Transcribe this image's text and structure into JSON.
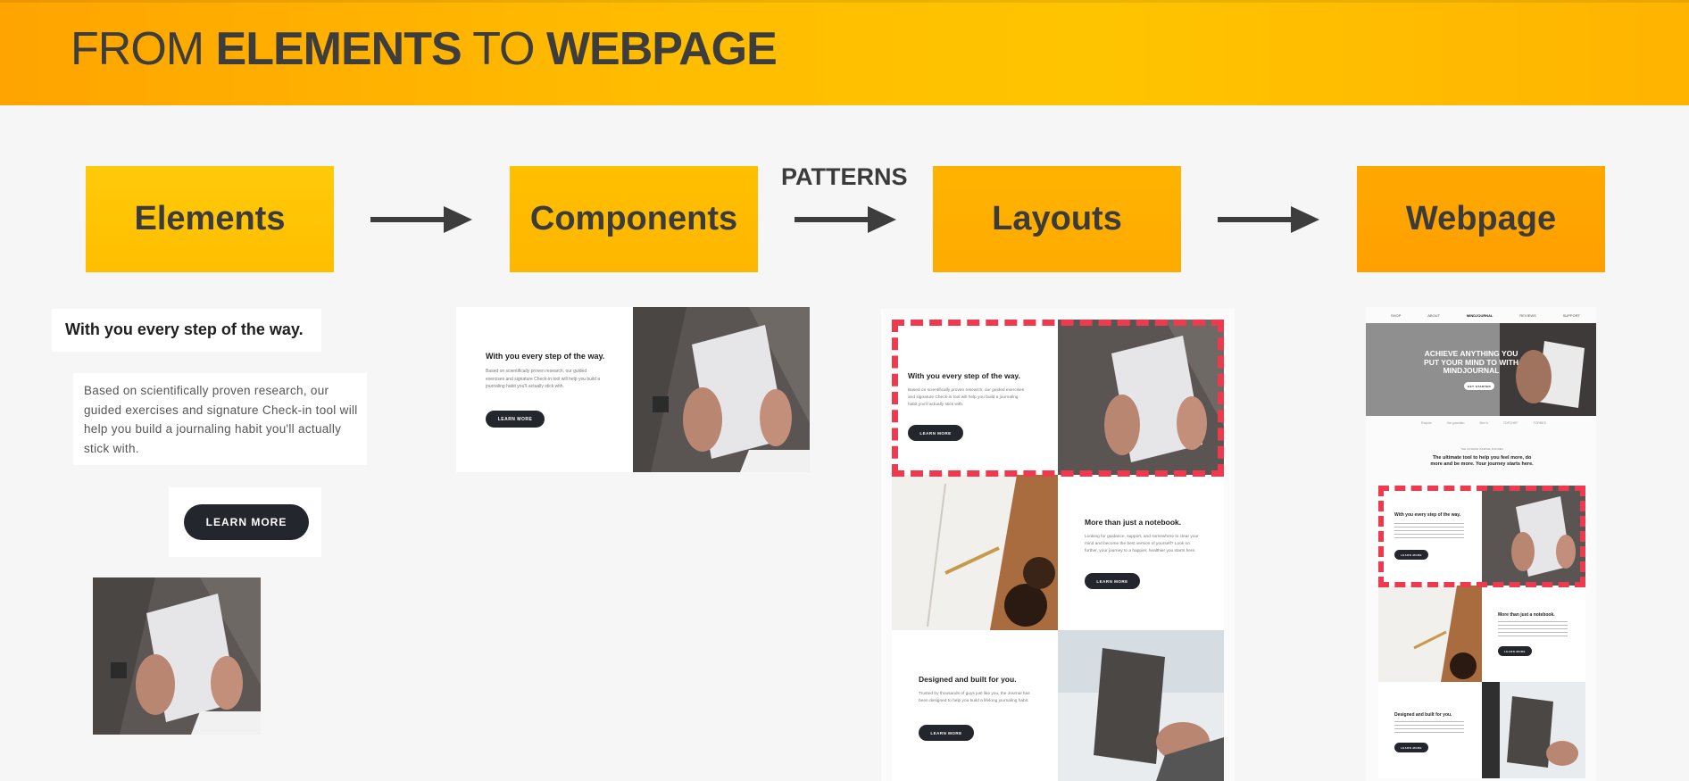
{
  "banner": {
    "title_parts": [
      "FROM",
      "ELEMENTS",
      "TO",
      "WEBPAGE"
    ],
    "background_colors": [
      "#ffa400",
      "#ffc400"
    ]
  },
  "flow": {
    "stages": [
      "Elements",
      "Components",
      "Layouts",
      "Webpage"
    ],
    "patterns_label": "PATTERNS",
    "arrow_color": "#3d3d3d"
  },
  "elements": {
    "heading": "With you every step of the way.",
    "paragraph": "Based on scientifically proven research, our guided exercises and signature Check-in tool will help you build a journaling habit you'll actually stick with.",
    "button": "LEARN MORE",
    "image": "hands-holding-notebook-photo"
  },
  "component": {
    "heading": "With you every step of the way.",
    "paragraph": "Based on scientifically proven research, our guided exercises and signature Check-in tool will help you build a journaling habit you'll actually stick with.",
    "button": "LEARN MORE"
  },
  "layout": {
    "sections": [
      {
        "heading": "With you every step of the way.",
        "paragraph": "Based on scientifically proven research, our guided exercises and signature Check-in tool will help you build a journaling habit you'll actually stick with.",
        "button": "LEARN MORE"
      },
      {
        "heading": "More than just a notebook.",
        "paragraph": "Looking for guidance, support, and somewhere to clear your mind and become the best version of yourself? Look no further, your journey to a happier, healthier you starts here.",
        "button": "LEARN MORE"
      },
      {
        "heading": "Designed and built for you.",
        "paragraph": "Trusted by thousands of guys just like you, the Journal has been designed to help you build a lifelong journaling habit.",
        "button": "LEARN MORE"
      }
    ],
    "highlight_color": "#ee3a4e"
  },
  "webpage": {
    "nav": [
      "SHOP",
      "ABOUT",
      "MINDJOURNAL",
      "REVIEWS",
      "SUPPORT"
    ],
    "hero_title": "ACHIEVE ANYTHING YOU PUT YOUR MIND TO WITH MINDJOURNAL",
    "hero_button": "GET STARTED",
    "press": [
      "Esquire",
      "the guardian",
      "Men's",
      "TOPCHEF",
      "FORBES"
    ],
    "intro_kicker": "THE ULTIMATE JOURNAL FOR MEN",
    "intro": "The ultimate tool to help you feel more, do more and be more. Your journey starts here.",
    "sections": [
      {
        "heading": "With you every step of the way.",
        "button": "LEARN MORE"
      },
      {
        "heading": "More than just a notebook.",
        "button": "LEARN MORE"
      },
      {
        "heading": "Designed and built for you.",
        "button": "LEARN MORE"
      }
    ]
  }
}
